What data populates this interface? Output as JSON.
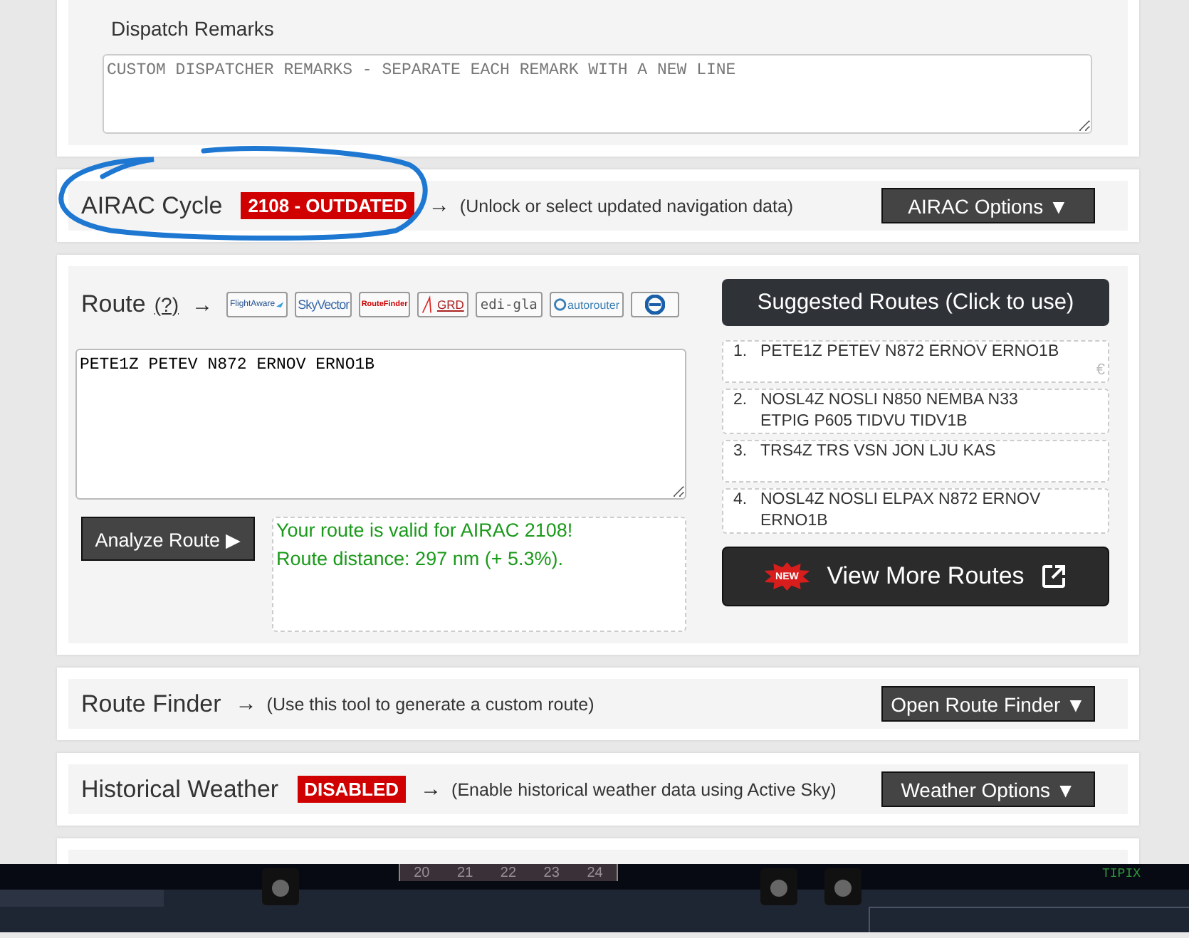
{
  "remarks": {
    "label": "Dispatch Remarks",
    "placeholder": "CUSTOM DISPATCHER REMARKS - SEPARATE EACH REMARK WITH A NEW LINE"
  },
  "airac": {
    "title": "AIRAC Cycle",
    "badge": "2108 - OUTDATED",
    "arrow": "→",
    "hint": "(Unlock or select updated navigation data)",
    "button": "AIRAC Options ▼",
    "highlighted": true
  },
  "route": {
    "title": "Route",
    "help": "(?)",
    "arrow": "→",
    "services": [
      {
        "kind": "flightaware",
        "label": "FlightAware"
      },
      {
        "kind": "skyvector",
        "label": "SkyVector"
      },
      {
        "kind": "routefinder",
        "label": "RouteFinder"
      },
      {
        "kind": "grd",
        "label": "GRD"
      },
      {
        "kind": "edigla",
        "label": "edi-gla"
      },
      {
        "kind": "autorouter",
        "label": "autorouter"
      },
      {
        "kind": "eurocontrol"
      }
    ],
    "value": "PETE1Z PETEV N872 ERNOV ERNO1B",
    "analyze_button": "Analyze Route ▶",
    "results": [
      "Your route is valid for AIRAC 2108!",
      "Route distance: 297 nm (+ 5.3%)."
    ],
    "suggested_title": "Suggested Routes (Click to use)",
    "suggested": [
      {
        "number": "1.",
        "route": "PETE1Z PETEV N872 ERNOV ERNO1B",
        "mark": "€"
      },
      {
        "number": "2.",
        "route": "NOSL4Z NOSLI N850 NEMBA N33 ETPIG P605 TIDVU TIDV1B"
      },
      {
        "number": "3.",
        "route": "TRS4Z TRS VSN JON LJU KAS"
      },
      {
        "number": "4.",
        "route": "NOSL4Z NOSLI ELPAX N872 ERNOV ERNO1B"
      }
    ],
    "new_badge": "NEW",
    "more_button": "View More Routes"
  },
  "route_finder": {
    "title": "Route Finder",
    "arrow": "→",
    "hint": "(Use this tool to generate a custom route)",
    "button": "Open Route Finder ▼"
  },
  "historical_weather": {
    "title": "Historical Weather",
    "badge": "DISABLED",
    "arrow": "→",
    "hint": "(Enable historical weather data using Active Sky)",
    "button": "Weather Options ▼"
  },
  "sim_overlay": {
    "scale": [
      "20",
      "21",
      "22",
      "23",
      "24"
    ],
    "label": "TIPIX"
  }
}
